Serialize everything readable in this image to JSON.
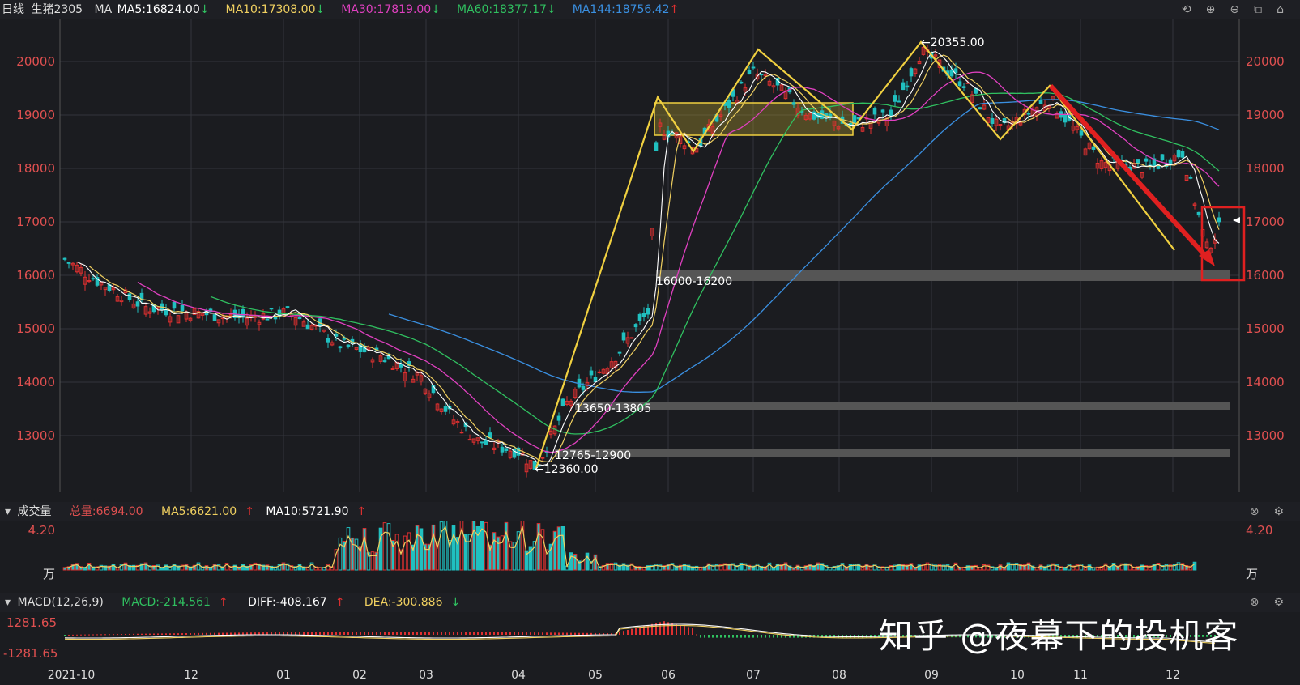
{
  "header": {
    "period": "日线",
    "symbol": "生猪2305",
    "ma_label": "MA",
    "ma": [
      {
        "text": "MA5:16824.00",
        "arrow": "↓",
        "color": "#ffffff"
      },
      {
        "text": "MA10:17308.00",
        "arrow": "↓",
        "color": "#f0d060"
      },
      {
        "text": "MA30:17819.00",
        "arrow": "↓",
        "color": "#e040c0"
      },
      {
        "text": "MA60:18377.17",
        "arrow": "↓",
        "color": "#30c060"
      },
      {
        "text": "MA144:18756.42",
        "arrow": "↑",
        "color": "#3a8fe0"
      }
    ]
  },
  "toolbar": [
    "⟲",
    "⊕",
    "⊖",
    "⧉",
    "⌂"
  ],
  "price_axis": [
    "20000",
    "19000",
    "18000",
    "17000",
    "16000",
    "15000",
    "14000",
    "13000"
  ],
  "annotations": {
    "high": "20355.00",
    "low": "12360.00",
    "zone1": "16000-16200",
    "zone2": "13650-13805",
    "zone3": "12765-12900"
  },
  "volume": {
    "title": "成交量",
    "total": "总量:6694.00",
    "ma5": "MA5:6621.00",
    "ma5_arrow": "↑",
    "ma10": "MA10:5721.90",
    "ma10_arrow": "↑",
    "axis_top": "4.20",
    "unit": "万"
  },
  "macd": {
    "title": "MACD(12,26,9)",
    "macd": "MACD:-214.561",
    "macd_arrow": "↑",
    "diff": "DIFF:-408.167",
    "diff_arrow": "↑",
    "dea": "DEA:-300.886",
    "dea_arrow": "↓",
    "axis_top": "1281.65",
    "axis_bot": "-1281.65"
  },
  "xaxis": [
    "2021-10",
    "12",
    "01",
    "02",
    "03",
    "04",
    "05",
    "06",
    "07",
    "08",
    "09",
    "10",
    "11",
    "12"
  ],
  "watermark": "知乎 @夜幕下的投机客",
  "colors": {
    "up": "#e03030",
    "down": "#20c0c0",
    "accent": "#f0d040"
  }
}
